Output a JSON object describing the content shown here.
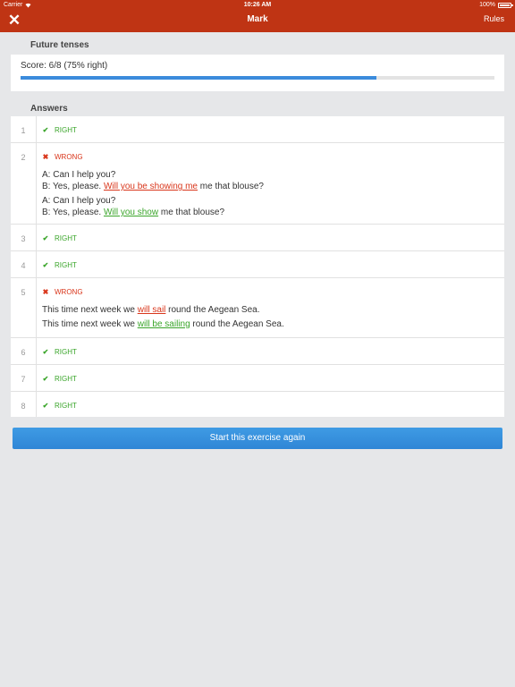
{
  "status": {
    "carrier": "Carrier",
    "wifi_icon": "wifi-icon",
    "time": "10:26 AM",
    "battery": "100%"
  },
  "nav": {
    "close_icon": "✕",
    "title": "Mark",
    "rules_label": "Rules"
  },
  "score_section": {
    "heading": "Future tenses",
    "score_text": "Score: 6/8 (75% right)",
    "progress_fraction": 0.75
  },
  "answers": {
    "heading": "Answers",
    "items": [
      {
        "num": "1",
        "status": "RIGHT"
      },
      {
        "num": "2",
        "status": "WRONG",
        "user_answer": {
          "line1": "A: Can I help you?",
          "prefix": "B: Yes, please. ",
          "answer": "Will you be showing me",
          "suffix": " me that blouse?"
        },
        "correct_answer": {
          "line1": "A: Can I help you?",
          "prefix": "B: Yes, please. ",
          "answer": "Will you show",
          "suffix": " me that blouse?"
        }
      },
      {
        "num": "3",
        "status": "RIGHT"
      },
      {
        "num": "4",
        "status": "RIGHT"
      },
      {
        "num": "5",
        "status": "WRONG",
        "user_answer": {
          "prefix": "This time next week we ",
          "answer": "will sail",
          "suffix": " round the Aegean Sea."
        },
        "correct_answer": {
          "prefix": "This time next week we ",
          "answer": "will be sailing",
          "suffix": " round the Aegean Sea."
        }
      },
      {
        "num": "6",
        "status": "RIGHT"
      },
      {
        "num": "7",
        "status": "RIGHT"
      },
      {
        "num": "8",
        "status": "RIGHT"
      }
    ]
  },
  "actions": {
    "restart_label": "Start this exercise again"
  },
  "colors": {
    "nav_bg": "#bf3414",
    "right": "#3aa52a",
    "wrong": "#d9361b",
    "progress": "#3b8bdc",
    "button": "#3790dc"
  }
}
